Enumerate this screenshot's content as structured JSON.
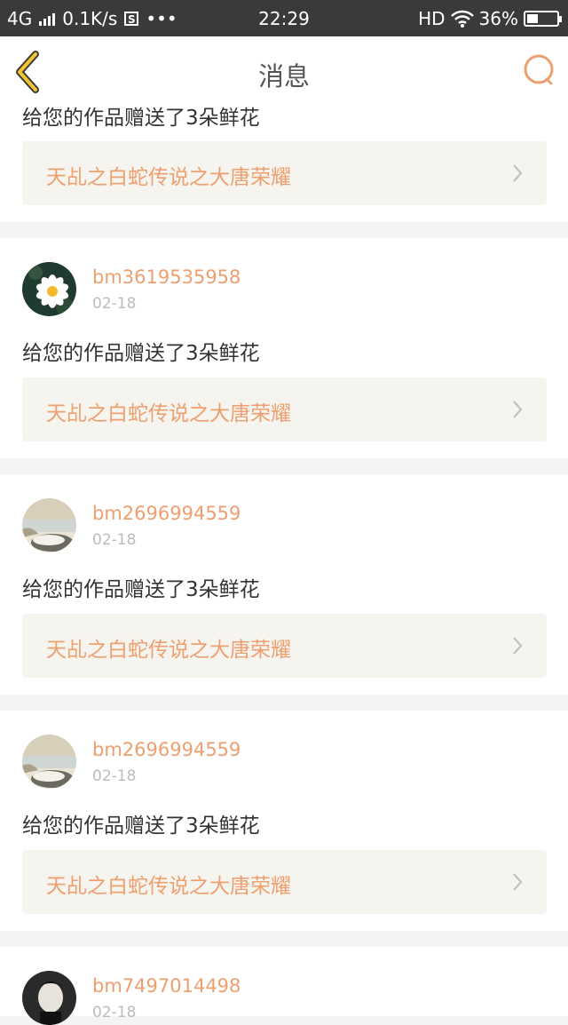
{
  "status_bar": {
    "network": "4G",
    "speed": "0.1K/s",
    "s_icon_text": "S",
    "more": "•••",
    "time": "22:29",
    "hd": "HD",
    "battery": "36%",
    "battery_level": 0.36
  },
  "header": {
    "title": "消息"
  },
  "colors": {
    "accent": "#ee9f6f",
    "back_chevron": "#f2c434",
    "work_bg": "#f5f4ee"
  },
  "items": [
    {
      "message": "给您的作品赠送了3朵鲜花",
      "work_title": "天乩之白蛇传说之大唐荣耀"
    },
    {
      "username": "bm3619535958",
      "date": "02-18",
      "message": "给您的作品赠送了3朵鲜花",
      "work_title": "天乩之白蛇传说之大唐荣耀",
      "avatar_icon": "daisy-flower-avatar"
    },
    {
      "username": "bm2696994559",
      "date": "02-18",
      "message": "给您的作品赠送了3朵鲜花",
      "work_title": "天乩之白蛇传说之大唐荣耀",
      "avatar_icon": "beach-scene-avatar"
    },
    {
      "username": "bm2696994559",
      "date": "02-18",
      "message": "给您的作品赠送了3朵鲜花",
      "work_title": "天乩之白蛇传说之大唐荣耀",
      "avatar_icon": "beach-scene-avatar"
    },
    {
      "username": "bm7497014498",
      "date": "02-18",
      "avatar_icon": "person-avatar"
    }
  ]
}
